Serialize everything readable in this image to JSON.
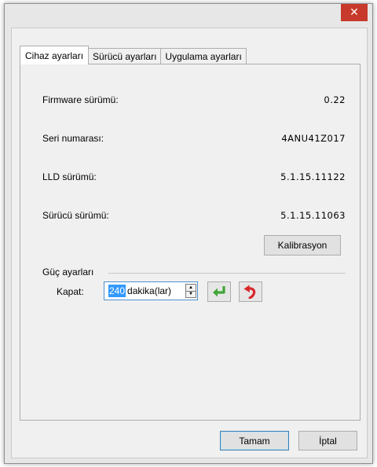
{
  "window": {
    "close_glyph": "✕"
  },
  "tabs": [
    {
      "label": "Cihaz ayarları",
      "active": true
    },
    {
      "label": "Sürücü ayarları",
      "active": false
    },
    {
      "label": "Uygulama ayarları",
      "active": false
    }
  ],
  "device_info": [
    {
      "label": "Firmware sürümü:",
      "value": "0.22"
    },
    {
      "label": "Seri numarası:",
      "value": "4ANU41Z017"
    },
    {
      "label": "LLD sürümü:",
      "value": "5.1.15.11122"
    },
    {
      "label": "Sürücü sürümü:",
      "value": "5.1.15.11063"
    }
  ],
  "calibration_label": "Kalibrasyon",
  "power": {
    "group_label": "Güç ayarları",
    "off_label": "Kapat:",
    "off_value": "240",
    "off_unit": "dakika(lar)",
    "apply_icon": "green-enter-arrow-icon",
    "reset_icon": "red-undo-arrow-icon"
  },
  "footer": {
    "ok_label": "Tamam",
    "cancel_label": "İptal"
  },
  "colors": {
    "close_button": "#c7392b",
    "selection": "#3399ff",
    "apply_green": "#3fa535",
    "reset_red": "#d9282b"
  }
}
